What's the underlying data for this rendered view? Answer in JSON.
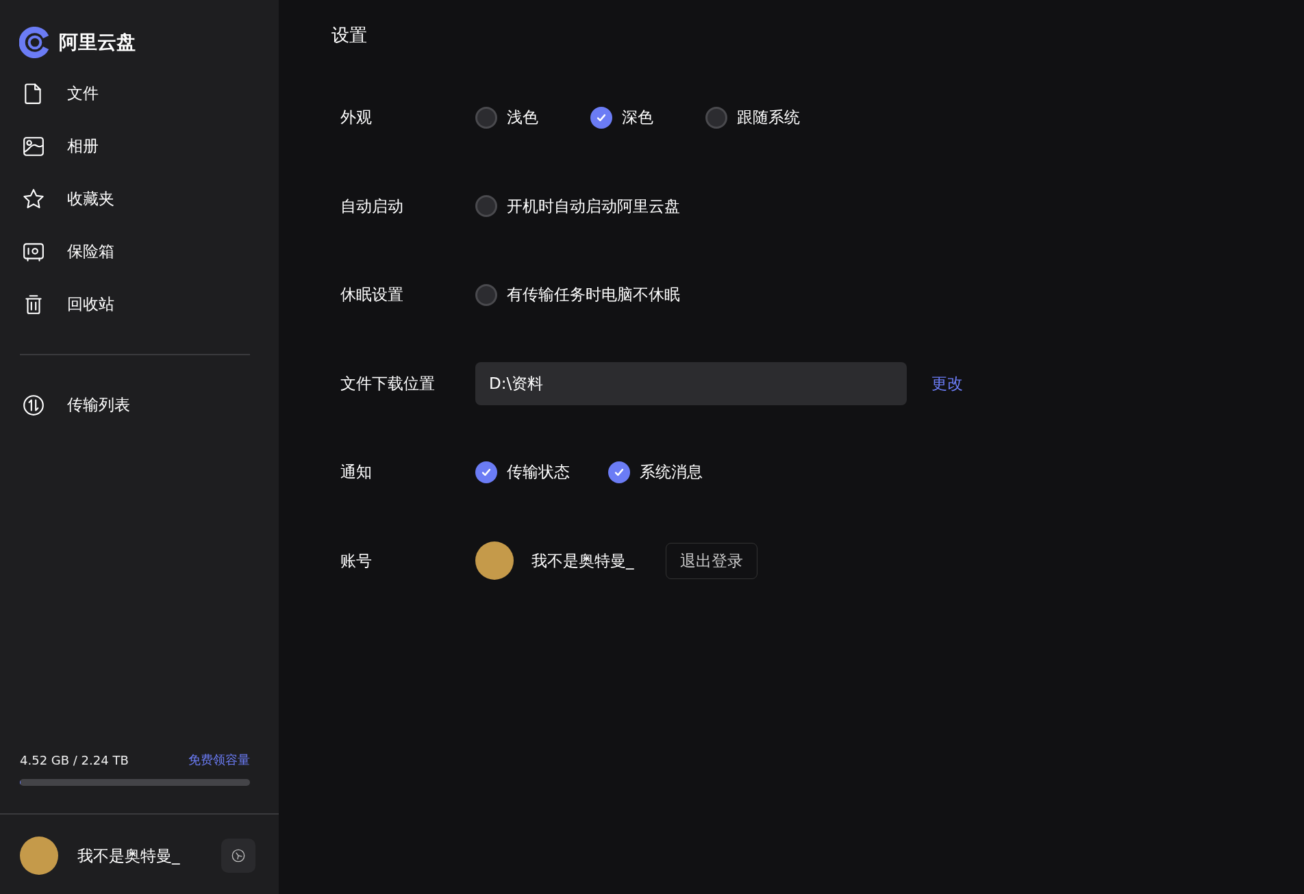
{
  "app": {
    "name": "阿里云盘"
  },
  "sidebar": {
    "items": [
      {
        "label": "文件",
        "kind": "file",
        "selected": false
      },
      {
        "label": "相册",
        "kind": "photo",
        "selected": false
      },
      {
        "label": "收藏夹",
        "kind": "star",
        "selected": false
      },
      {
        "label": "保险箱",
        "kind": "safe",
        "selected": false
      },
      {
        "label": "回收站",
        "kind": "trash",
        "selected": false
      }
    ],
    "bottom_items": [
      {
        "label": "传输列表",
        "kind": "transfer",
        "selected": false
      }
    ],
    "storage": {
      "usage": "4.52 GB / 2.24 TB",
      "link": "免费领容量",
      "level": 0.003
    },
    "user": {
      "name": "我不是奥特曼_"
    }
  },
  "settings": {
    "title": "设置",
    "rows": [
      {
        "label": "外观",
        "kind": "radio",
        "options": [
          {
            "label": "浅色",
            "selected": false
          },
          {
            "label": "深色",
            "selected": true
          },
          {
            "label": "跟随系统",
            "selected": false
          }
        ]
      },
      {
        "label": "自动启动",
        "kind": "checkbox",
        "options": [
          {
            "label": "开机时自动启动阿里云盘",
            "checked": false
          }
        ]
      },
      {
        "label": "休眠设置",
        "kind": "checkbox",
        "options": [
          {
            "label": "有传输任务时电脑不休眠",
            "checked": false
          }
        ]
      },
      {
        "label": "文件下载位置",
        "kind": "path",
        "value": "D:\\资料",
        "action": "更改"
      },
      {
        "label": "通知",
        "kind": "checkbox",
        "options": [
          {
            "label": "传输状态",
            "checked": true
          },
          {
            "label": "系统消息",
            "checked": true
          }
        ]
      },
      {
        "label": "账号",
        "kind": "account",
        "name": "我不是奥特曼_",
        "action": "退出登录"
      }
    ]
  }
}
